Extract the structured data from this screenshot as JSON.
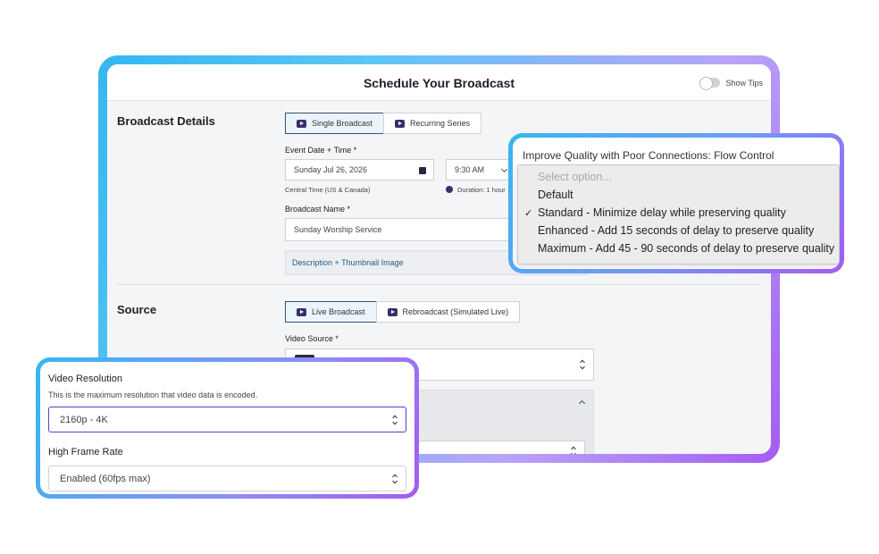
{
  "header": {
    "title": "Schedule Your Broadcast",
    "tips_label": "Show Tips"
  },
  "broadcast_details": {
    "title": "Broadcast Details",
    "tabs": [
      {
        "label": "Single Broadcast",
        "active": true
      },
      {
        "label": "Recurring Series",
        "active": false
      }
    ],
    "date_label": "Event Date + Time *",
    "date_value": "Sunday Jul 26, 2026",
    "time_value": "9:30 AM",
    "timezone": "Central Time (US & Canada)",
    "duration": "Duration: 1 hour",
    "name_label": "Broadcast Name *",
    "name_value": "Sunday Worship Service",
    "description_link": "Description + Thumbnail Image"
  },
  "source": {
    "title": "Source",
    "tabs": [
      {
        "label": "Live Broadcast",
        "active": true
      },
      {
        "label": "Rebroadcast (Simulated Live)",
        "active": false
      }
    ],
    "video_source_label": "Video Source *"
  },
  "quality_dropdown": {
    "title": "Improve Quality with Poor Connections: Flow Control",
    "placeholder": "Select option...",
    "options": [
      {
        "label": "Default",
        "selected": false
      },
      {
        "label": "Standard - Minimize delay while preserving quality",
        "selected": true
      },
      {
        "label": "Enhanced - Add 15 seconds of delay to preserve quality",
        "selected": false
      },
      {
        "label": "Maximum - Add 45 - 90 seconds of delay to preserve quality",
        "selected": false
      }
    ],
    "check_mark": "✓"
  },
  "resolution_card": {
    "resolution_label": "Video Resolution",
    "resolution_hint": "This is the maximum resolution that video data is encoded.",
    "resolution_value": "2160p - 4K",
    "frame_rate_label": "High Frame Rate",
    "frame_rate_value": "Enabled (60fps max)"
  },
  "colors": {
    "accent_dark": "#3a2e6b",
    "active_tab_bg": "#eaf5fb",
    "gradient_start": "#34b6f0",
    "gradient_end": "#a45cf2",
    "link": "#1f5d8a"
  }
}
